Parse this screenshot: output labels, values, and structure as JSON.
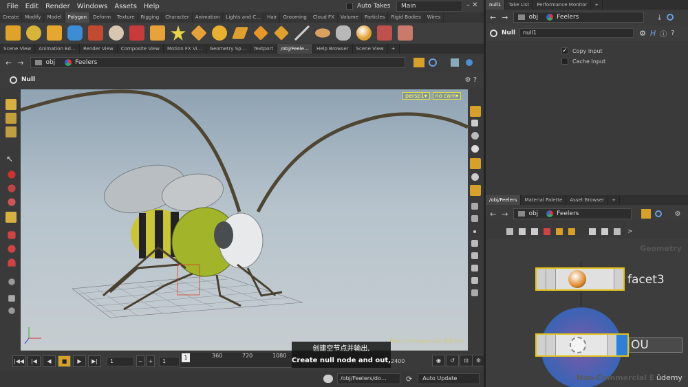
{
  "menubar": {
    "items": [
      "File",
      "Edit",
      "Render",
      "Windows",
      "Assets",
      "Help"
    ],
    "auto_takes": "Auto Takes",
    "desktop": "Main",
    "win_controls": "– ✕"
  },
  "shelf": {
    "tabs": [
      "Create",
      "Modify",
      "Model",
      "Polygon",
      "Deform",
      "Texture",
      "Rigging",
      "Character",
      "Animation",
      "Lights and C…",
      "Hair",
      "Grooming",
      "Cloud FX",
      "Volume",
      "Particles",
      "Rigid Bodies",
      "Wires"
    ],
    "active_tab": 3,
    "icon_colors": [
      "#e0a32a",
      "#d8b43a",
      "#e5a730",
      "#3c8dd6",
      "#c24a30",
      "#d8c7b0",
      "#c93a3a",
      "#e8a23a",
      "#e6d54a",
      "#e6a23a",
      "#e8b030",
      "#e0a030",
      "#e8962a",
      "#cccccc",
      "#d9a060",
      "#b8b8b8",
      "#e0a030",
      "#c0504d",
      "#c97a6a"
    ]
  },
  "left_pane": {
    "tabs": [
      "Scene View",
      "Animation Ed…",
      "Render View",
      "Composite View",
      "Motion FX Vi…",
      "Geometry Sp…",
      "Textport",
      "/obj/Feele…",
      "Help Browser",
      "Scene View"
    ],
    "active_tab": 7,
    "path": [
      "obj",
      "Feelers"
    ],
    "tool_label": "Null"
  },
  "viewport": {
    "camera": "persp1▾",
    "cam_menu": "no cam▾",
    "watermark": "Non-Commercial Edition"
  },
  "timeline": {
    "frame": "1",
    "start": "1",
    "current": "1",
    "marks": [
      "360",
      "720",
      "1080"
    ],
    "end": "2400",
    "end_field": "2400"
  },
  "subtitle": {
    "zh": "创建空节点并输出,",
    "en": "Create null node and out,"
  },
  "bottombar": {
    "path": "/obj/Feelers/do…",
    "update": "Auto Update"
  },
  "right_top": {
    "tabs": [
      "null1",
      "Take List",
      "Performance Monitor"
    ],
    "active_tab": 0,
    "path": [
      "obj",
      "Feelers"
    ],
    "node_type": "Null",
    "node_name": "null1",
    "params": [
      {
        "label": "Copy Input",
        "checked": true
      },
      {
        "label": "Cache Input",
        "checked": false
      }
    ]
  },
  "network": {
    "tabs": [
      "/obj/Feelers",
      "Material Palette",
      "Asset Browser"
    ],
    "active_tab": 0,
    "path": [
      "obj",
      "Feelers"
    ],
    "context": "Geometry",
    "node1": "facet3",
    "node2": "OU",
    "watermark": "Non-Commercial E",
    "brand": "ûdemy"
  },
  "colors": {
    "accent_yellow": "#e3c21a",
    "selected_blue": "#2e7fd8",
    "timeline_active": "#d6a02a"
  }
}
